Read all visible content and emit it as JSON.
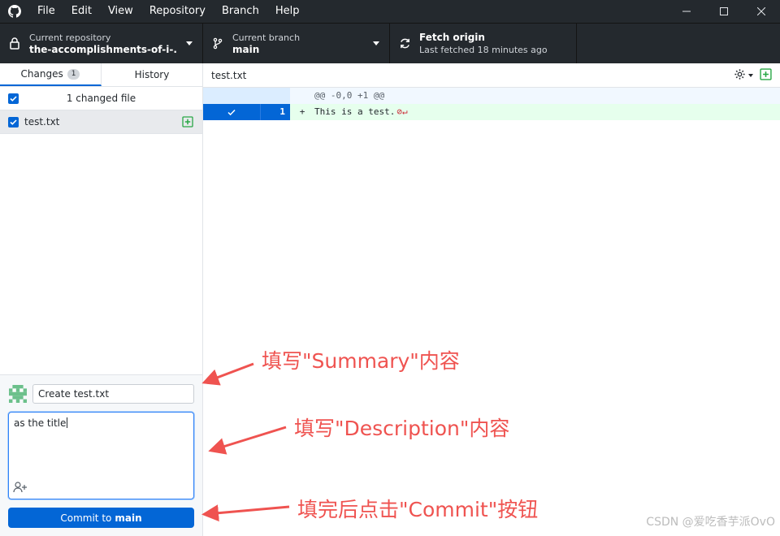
{
  "menu": [
    "File",
    "Edit",
    "View",
    "Repository",
    "Branch",
    "Help"
  ],
  "window_controls": {
    "minimize": "minimize-icon",
    "maximize": "maximize-icon",
    "close": "close-icon"
  },
  "toolbar": {
    "repo": {
      "title": "Current repository",
      "value": "the-accomplishments-of-i-..."
    },
    "branch": {
      "title": "Current branch",
      "value": "main"
    },
    "fetch": {
      "title": "Fetch origin",
      "value": "Last fetched 18 minutes ago"
    }
  },
  "tabs": {
    "changes": "Changes",
    "changes_count": "1",
    "history": "History"
  },
  "changes": {
    "header": "1 changed file",
    "files": [
      {
        "name": "test.txt",
        "status": "added"
      }
    ]
  },
  "commit": {
    "summary": "Create test.txt",
    "description": "as the title",
    "button_prefix": "Commit to",
    "button_branch": "main"
  },
  "diff": {
    "path": "test.txt",
    "hunk_header": "@@ -0,0 +1 @@",
    "lines": [
      {
        "num": "1",
        "sign": "+",
        "text": "This is a test."
      }
    ]
  },
  "annotations": {
    "summary": "填写\"Summary\"内容",
    "description": "填写\"Description\"内容",
    "commit": "填完后点击\"Commit\"按钮"
  },
  "watermark": "CSDN @爱吃香芋派OvO",
  "colors": {
    "accent": "#0366d6",
    "added_bg": "#e6ffed",
    "annotation": "#ef5350",
    "titlebar": "#24292e"
  }
}
